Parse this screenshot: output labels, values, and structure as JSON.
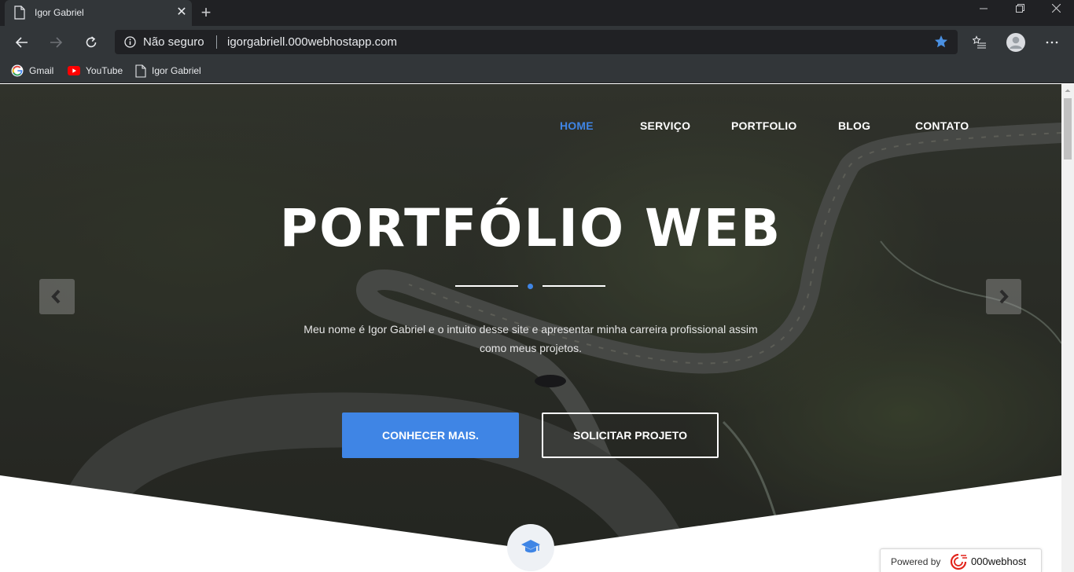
{
  "browser": {
    "tab_title": "Igor Gabriel",
    "tab_close": "✕",
    "new_tab": "+",
    "security_label": "Não seguro",
    "url": "igorgabriell.000webhostapp.com",
    "bookmarks": [
      {
        "label": "Gmail",
        "icon": "google-icon"
      },
      {
        "label": "YouTube",
        "icon": "youtube-icon"
      },
      {
        "label": "Igor Gabriel",
        "icon": "page-icon"
      }
    ]
  },
  "site": {
    "nav": [
      "HOME",
      "SERVIÇO",
      "PORTFOLIO",
      "BLOG",
      "CONTATO"
    ],
    "active_nav": "HOME",
    "hero_title": "PORTFÓLIO WEB",
    "hero_text": "Meu nome é Igor Gabriel e o intuito desse site e apresentar minha carreira profissional assim como meus projetos.",
    "primary_button": "CONHECER MAIS.",
    "secondary_button": "SOLICITAR PROJETO",
    "section_icon": "graduation-cap-icon",
    "accent_color": "#3f85e5"
  },
  "powered": {
    "label": "Powered by",
    "brand": "000webhost"
  }
}
